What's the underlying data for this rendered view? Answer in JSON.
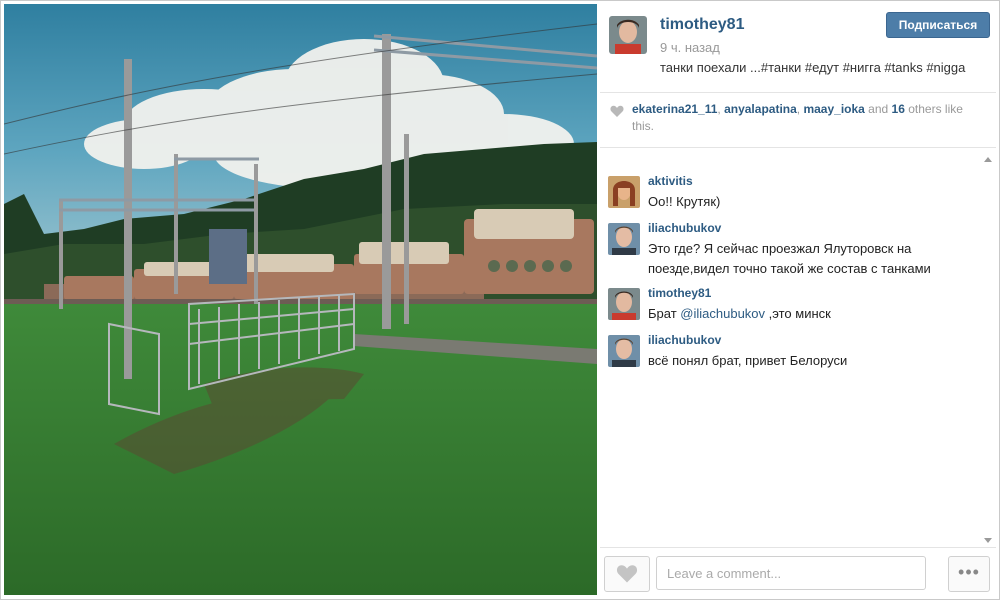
{
  "post": {
    "username": "timothey81",
    "time_ago": "9 ч. назад",
    "caption": "танки поехали ...#танки #едут #нигга #tanks #nigga",
    "follow_label": "Подписаться"
  },
  "likes": {
    "user1": "ekaterina21_11",
    "sep1": ", ",
    "user2": "anyalapatina",
    "sep2": ", ",
    "user3": "maay_ioka",
    "and": " and ",
    "count": "16",
    "rest": " others like this."
  },
  "comments": [
    {
      "user": "aktivitis",
      "text": "Оо!! Крутяк)"
    },
    {
      "user": "iliachubukov",
      "text": "Это где? Я сейчас проезжал Ялуторовск на поезде,видел точно такой же состав с танками"
    },
    {
      "user": "timothey81",
      "text_before": "Брат ",
      "mention": "@iliachubukov",
      "text_after": " ,это минск"
    },
    {
      "user": "iliachubukov",
      "text": "всё понял брат, привет Белоруси"
    }
  ],
  "comment_input": {
    "placeholder": "Leave a comment..."
  },
  "more_label": "•••",
  "icons": [
    "heart-icon",
    "more-icon"
  ],
  "colors": {
    "link": "#2d5b82",
    "follow_button": "#4d7da8",
    "muted": "#999999"
  }
}
